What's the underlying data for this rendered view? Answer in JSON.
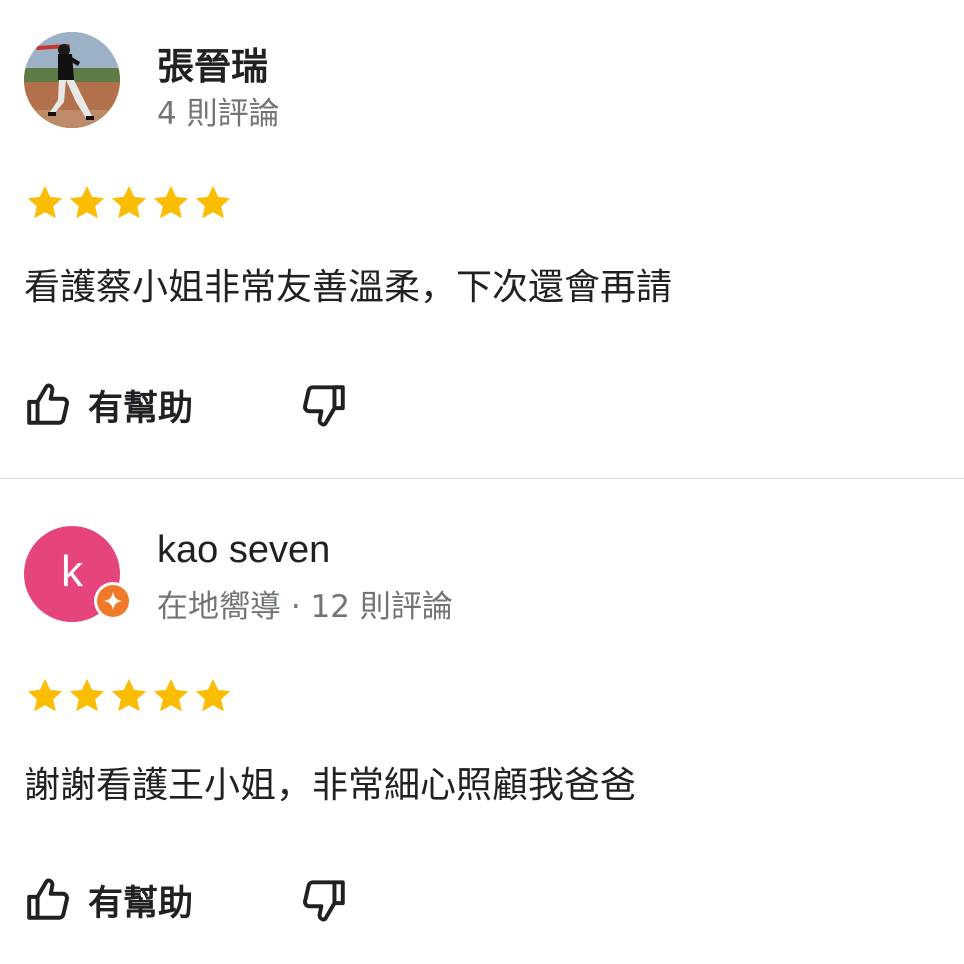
{
  "reviews": [
    {
      "reviewer_name": "張晉瑞",
      "reviewer_meta": "4 則評論",
      "avatar": "photo-baseball-player",
      "rating": 5,
      "text": "看護蔡小姐非常友善溫柔，下次還會再請",
      "helpful_label": "有幫助"
    },
    {
      "reviewer_name": "kao seven",
      "reviewer_meta": "在地嚮導 · 12 則評論",
      "avatar": "letter-avatar",
      "avatar_letter": "k",
      "avatar_color": "#e5447c",
      "badge": "local-guide-badge",
      "badge_color": "#f0792a",
      "rating": 5,
      "text": "謝謝看護王小姐，非常細心照顧我爸爸",
      "helpful_label": "有幫助"
    }
  ],
  "colors": {
    "star": "#fbbc04",
    "meta_text": "#70757a",
    "divider": "#dadce0"
  },
  "icons": [
    "thumbs-up-icon",
    "thumbs-down-icon",
    "star-icon",
    "local-guide-badge-icon"
  ]
}
